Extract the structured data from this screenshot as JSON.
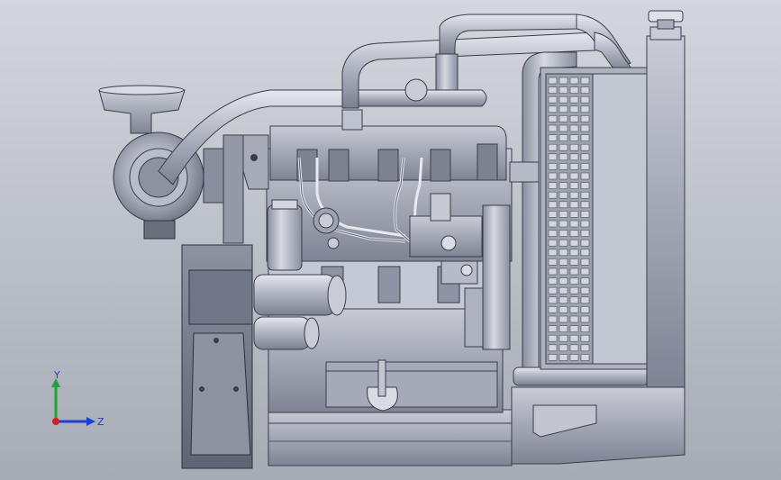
{
  "scene": {
    "background_top": "#d3d6dc",
    "background_bottom": "#a6abb6",
    "model_tint": "#9ea3b2"
  },
  "triad": {
    "y_label": "Y",
    "z_label": "Z",
    "y_color": "#1fa33a",
    "z_color": "#1d3fd0",
    "x_color": "#d21f1f"
  }
}
